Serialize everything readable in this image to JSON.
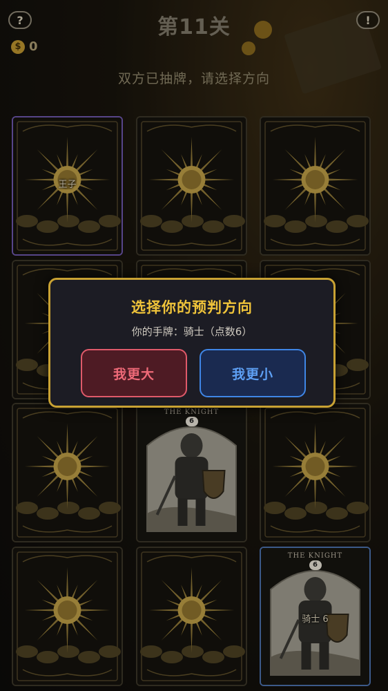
{
  "header": {
    "level_title": "第11关",
    "help_label": "?",
    "info_label": "!",
    "coin_symbol": "$",
    "coins": "0",
    "status": "双方已抽牌，请选择方向"
  },
  "cards": [
    {
      "row": 0,
      "col": 0,
      "face": "back",
      "label": "王子",
      "border": "purple"
    },
    {
      "row": 0,
      "col": 1,
      "face": "back",
      "label": ""
    },
    {
      "row": 0,
      "col": 2,
      "face": "back",
      "label": ""
    },
    {
      "row": 1,
      "col": 0,
      "face": "back",
      "label": ""
    },
    {
      "row": 1,
      "col": 1,
      "face": "back",
      "label": ""
    },
    {
      "row": 1,
      "col": 2,
      "face": "back",
      "label": ""
    },
    {
      "row": 2,
      "col": 0,
      "face": "back",
      "label": ""
    },
    {
      "row": 2,
      "col": 1,
      "face": "knight",
      "label": "",
      "title": "THE KNIGHT",
      "number": "6"
    },
    {
      "row": 2,
      "col": 2,
      "face": "back",
      "label": ""
    },
    {
      "row": 3,
      "col": 0,
      "face": "back",
      "label": ""
    },
    {
      "row": 3,
      "col": 1,
      "face": "back",
      "label": ""
    },
    {
      "row": 3,
      "col": 2,
      "face": "knight",
      "label": "骑士 6",
      "title": "THE KNIGHT",
      "number": "6",
      "border": "blue"
    }
  ],
  "dialog": {
    "title": "选择你的预判方向",
    "subtitle": "你的手牌：骑士（点数6）",
    "bigger_label": "我更大",
    "smaller_label": "我更小"
  },
  "colors": {
    "gold": "#c9a233",
    "bigger_red": "#e05a6a",
    "smaller_blue": "#3f86e6",
    "card_border_purple": "#6b55a8",
    "card_border_blue": "#4a6ea8"
  }
}
